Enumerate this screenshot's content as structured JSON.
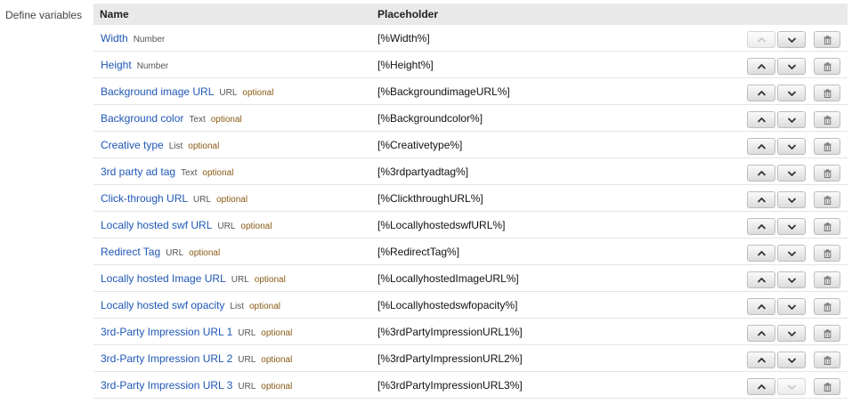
{
  "side_label": "Define variables",
  "columns": {
    "name": "Name",
    "placeholder": "Placeholder"
  },
  "rows": [
    {
      "name": "Width",
      "type": "Number",
      "optional": "",
      "placeholder": "[%Width%]",
      "up_enabled": false,
      "down_enabled": true
    },
    {
      "name": "Height",
      "type": "Number",
      "optional": "",
      "placeholder": "[%Height%]",
      "up_enabled": true,
      "down_enabled": true
    },
    {
      "name": "Background image URL",
      "type": "URL",
      "optional": "optional",
      "placeholder": "[%BackgroundimageURL%]",
      "up_enabled": true,
      "down_enabled": true
    },
    {
      "name": "Background color",
      "type": "Text",
      "optional": "optional",
      "placeholder": "[%Backgroundcolor%]",
      "up_enabled": true,
      "down_enabled": true
    },
    {
      "name": "Creative type",
      "type": "List",
      "optional": "optional",
      "placeholder": "[%Creativetype%]",
      "up_enabled": true,
      "down_enabled": true
    },
    {
      "name": "3rd party ad tag",
      "type": "Text",
      "optional": "optional",
      "placeholder": "[%3rdpartyadtag%]",
      "up_enabled": true,
      "down_enabled": true
    },
    {
      "name": "Click-through URL",
      "type": "URL",
      "optional": "optional",
      "placeholder": "[%ClickthroughURL%]",
      "up_enabled": true,
      "down_enabled": true
    },
    {
      "name": "Locally hosted swf URL",
      "type": "URL",
      "optional": "optional",
      "placeholder": "[%LocallyhostedswfURL%]",
      "up_enabled": true,
      "down_enabled": true
    },
    {
      "name": "Redirect Tag",
      "type": "URL",
      "optional": "optional",
      "placeholder": "[%RedirectTag%]",
      "up_enabled": true,
      "down_enabled": true
    },
    {
      "name": "Locally hosted Image URL",
      "type": "URL",
      "optional": "optional",
      "placeholder": "[%LocallyhostedImageURL%]",
      "up_enabled": true,
      "down_enabled": true
    },
    {
      "name": "Locally hosted swf opacity",
      "type": "List",
      "optional": "optional",
      "placeholder": "[%Locallyhostedswfopacity%]",
      "up_enabled": true,
      "down_enabled": true
    },
    {
      "name": "3rd-Party Impression URL 1",
      "type": "URL",
      "optional": "optional",
      "placeholder": "[%3rdPartyImpressionURL1%]",
      "up_enabled": true,
      "down_enabled": true
    },
    {
      "name": "3rd-Party Impression URL 2",
      "type": "URL",
      "optional": "optional",
      "placeholder": "[%3rdPartyImpressionURL2%]",
      "up_enabled": true,
      "down_enabled": true
    },
    {
      "name": "3rd-Party Impression URL 3",
      "type": "URL",
      "optional": "optional",
      "placeholder": "[%3rdPartyImpressionURL3%]",
      "up_enabled": true,
      "down_enabled": false
    }
  ],
  "icons": {
    "up": "chevron-up-icon",
    "down": "chevron-down-icon",
    "delete": "trash-icon"
  }
}
